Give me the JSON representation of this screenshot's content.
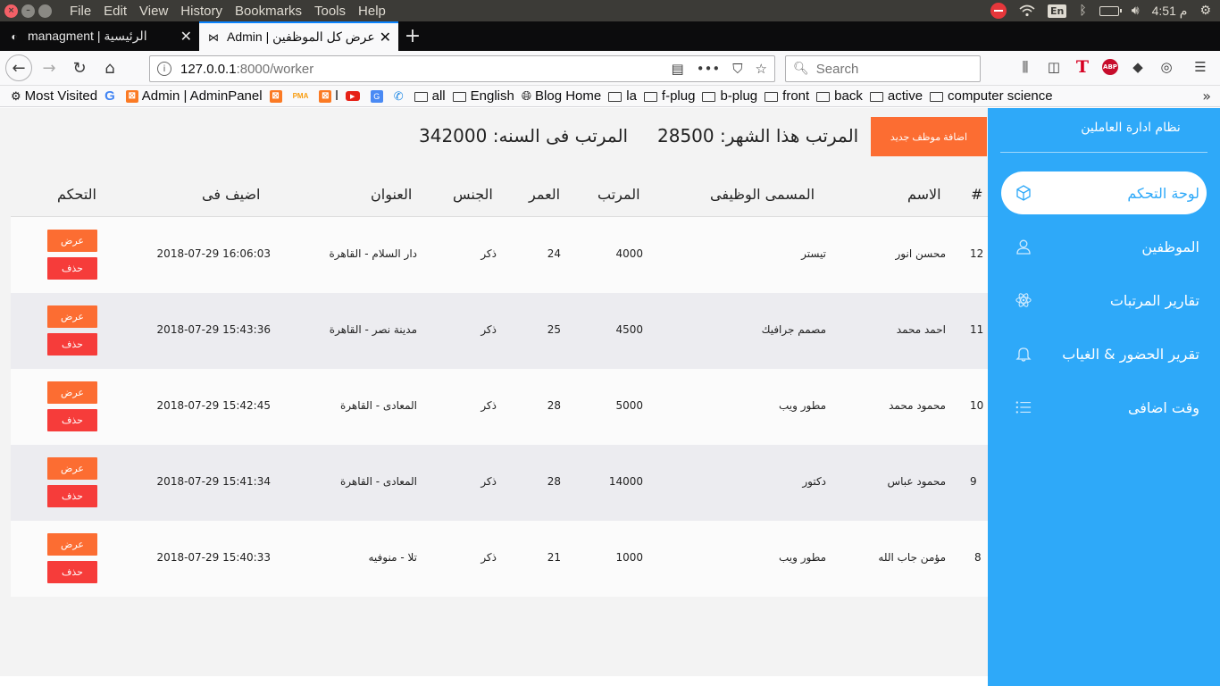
{
  "os": {
    "menu": [
      "File",
      "Edit",
      "View",
      "History",
      "Bookmarks",
      "Tools",
      "Help"
    ],
    "keyboard_lang": "En",
    "clock": "4:51 م"
  },
  "tabs": [
    {
      "title": "managment | الرئيسية",
      "active": false
    },
    {
      "title": "Admin | عرض كل الموظفين",
      "active": true
    }
  ],
  "url": {
    "host": "127.0.0.1",
    "rest": ":8000/worker"
  },
  "search": {
    "placeholder": "Search"
  },
  "bookmarks": [
    "Most Visited",
    "Admin | AdminPanel",
    "l",
    "all",
    "English",
    "Blog Home",
    "la",
    "f-plug",
    "b-plug",
    "front",
    "back",
    "active",
    "computer science"
  ],
  "page": {
    "add_button": "اضافة موظف جديد",
    "salary_month": "المرتب هذا الشهر: 28500",
    "salary_year": "المرتب فى السنه: 342000"
  },
  "table": {
    "headers": {
      "id": "#",
      "name": "الاسم",
      "job": "المسمى الوظيفى",
      "salary": "المرتب",
      "age": "العمر",
      "gender": "الجنس",
      "address": "العنوان",
      "added": "اضيف فى",
      "actions": "التحكم"
    },
    "view_label": "عرض",
    "delete_label": "حذف",
    "rows": [
      {
        "id": "12",
        "name": "محسن انور",
        "job": "تيستر",
        "salary": "4000",
        "age": "24",
        "gender": "ذكر",
        "address": "دار السلام - القاهرة",
        "added": "2018-07-29 16:06:03"
      },
      {
        "id": "11",
        "name": "احمد محمد",
        "job": "مصمم جرافيك",
        "salary": "4500",
        "age": "25",
        "gender": "ذكر",
        "address": "مدينة نصر - القاهرة",
        "added": "2018-07-29 15:43:36"
      },
      {
        "id": "10",
        "name": "محمود محمد",
        "job": "مطور ويب",
        "salary": "5000",
        "age": "28",
        "gender": "ذكر",
        "address": "المعادى - القاهرة",
        "added": "2018-07-29 15:42:45"
      },
      {
        "id": "9",
        "name": "محمود عباس",
        "job": "دكتور",
        "salary": "14000",
        "age": "28",
        "gender": "ذكر",
        "address": "المعادى - القاهرة",
        "added": "2018-07-29 15:41:34"
      },
      {
        "id": "8",
        "name": "مؤمن جاب الله",
        "job": "مطور ويب",
        "salary": "1000",
        "age": "21",
        "gender": "ذكر",
        "address": "تلا - منوفيه",
        "added": "2018-07-29 15:40:33"
      }
    ]
  },
  "sidebar": {
    "title": "نظام ادارة العاملين",
    "items": [
      {
        "label": "لوحة التحكم",
        "icon": "cube-icon",
        "active": true
      },
      {
        "label": "الموظفين",
        "icon": "user-icon",
        "active": false
      },
      {
        "label": "تقارير المرتبات",
        "icon": "atom-icon",
        "active": false
      },
      {
        "label": "تقرير الحضور & الغياب",
        "icon": "bell-icon",
        "active": false
      },
      {
        "label": "وقت اضافى",
        "icon": "list-icon",
        "active": false
      }
    ]
  },
  "colors": {
    "accent": "#2ea9f9",
    "add_button": "#fc6d32",
    "delete_button": "#f63c3a"
  }
}
